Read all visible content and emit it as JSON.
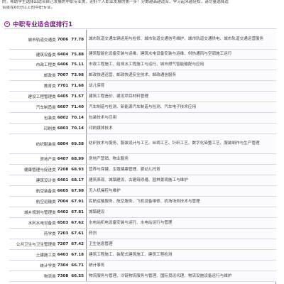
{
  "intro": {
    "lines": [
      "的，帮助学生选择出适合自己发展的中职专业类，迎好个人职业发展的第一步！分数越高越适合，学习起来越轻松，请尽量选择适",
      "合度在60分以上的中职专业。"
    ]
  },
  "section": {
    "title": "中职专业适合度排行1"
  },
  "rows": [
    {
      "name": "城市轨道交通类",
      "code": "7006",
      "score": "77.78",
      "desc": "城市轨道交通车辆运用与检修、城市轨道交通信号维护、城市轨道交通供电、城市轨道交通运营服务"
    },
    {
      "name": "建筑设备类",
      "code": "6404",
      "score": "75.88",
      "desc": "建筑智能化设备安装与运维、建筑水电设备安装与运维、供热通风与空调施工运行"
    },
    {
      "name": "市政工程类",
      "code": "6406",
      "score": "75.11",
      "desc": "市政工程施工、给排水工程施工与运行、城市燃气智能输配与应用"
    },
    {
      "name": "邮政类",
      "code": "7007",
      "score": "73.98",
      "desc": "邮政快递运营、邮政快递安全技术、邮政通信服务"
    },
    {
      "name": "教育类",
      "code": "7701",
      "score": "71.68",
      "desc": "幼儿保育"
    },
    {
      "name": "建设工程管理类",
      "code": "6405",
      "score": "71.57",
      "desc": "建筑工程造价、建设项目材料管理"
    },
    {
      "name": "汽车制造类",
      "code": "6607",
      "score": "71.40",
      "desc": "汽车制造与检测、新能源汽车制造与检测、汽车电子技术应用"
    },
    {
      "name": "包装类",
      "code": "6802",
      "score": "70.14",
      "desc": "包装技术与应用"
    },
    {
      "name": "印刷类",
      "code": "6803",
      "score": "70.14",
      "desc": "印刷媒体技术"
    },
    {
      "name": "纺织服装类",
      "code": "6804",
      "score": "69.58",
      "desc": "纺织技术与服务、服装设计与工艺、丝绸工艺、针织工艺、数字化染整工艺、服装制作与生产管理"
    },
    {
      "name": "房地产类",
      "code": "6407",
      "score": "68.99",
      "desc": "房地产营销、物业服务"
    },
    {
      "name": "健康管理与促进类",
      "code": "7208",
      "score": "68.93",
      "desc": "营养与保健、生殖健康管理、婴幼儿托育"
    },
    {
      "name": "建筑设计类",
      "code": "6401",
      "score": "68.17",
      "desc": "建筑表现、城镇建设、古建筑修缮、园林景观施工与维护"
    },
    {
      "name": "航空装备类",
      "code": "6605",
      "score": "67.98",
      "desc": "无人机操控与维护"
    },
    {
      "name": "航空运输类",
      "code": "7004",
      "score": "67.91",
      "desc": "民航运输服务、航空服务、飞机设备维修、机场场务技术与管理"
    },
    {
      "name": "城乡规划与管理类",
      "code": "6402",
      "score": "67.81",
      "desc": "城镇建设"
    },
    {
      "name": "水利水电设备类",
      "code": "6503",
      "score": "67.62",
      "desc": "水电站机电设备安装与运行、水电站运行与管理"
    },
    {
      "name": "药学类",
      "code": "7203",
      "score": "67.61",
      "desc": "药剂"
    },
    {
      "name": "公共卫生与卫生管理类",
      "code": "7207",
      "score": "67.42",
      "desc": "卫生信息管理"
    },
    {
      "name": "土建施工类",
      "code": "6403",
      "score": "67.18",
      "desc": "建筑工程施工、装配式建筑施工、建筑工程检测"
    },
    {
      "name": "统计学类",
      "code": "7304",
      "score": "66.71",
      "desc": "统计事务"
    },
    {
      "name": "物流类",
      "code": "7308",
      "score": "66.55",
      "desc": "物流服务与管理、冷链物流服务与管理、国际货运代理、物流设施设备运行与维护"
    }
  ],
  "colors": {
    "accent": "#7a1a84",
    "border": "#8f8fb0"
  }
}
